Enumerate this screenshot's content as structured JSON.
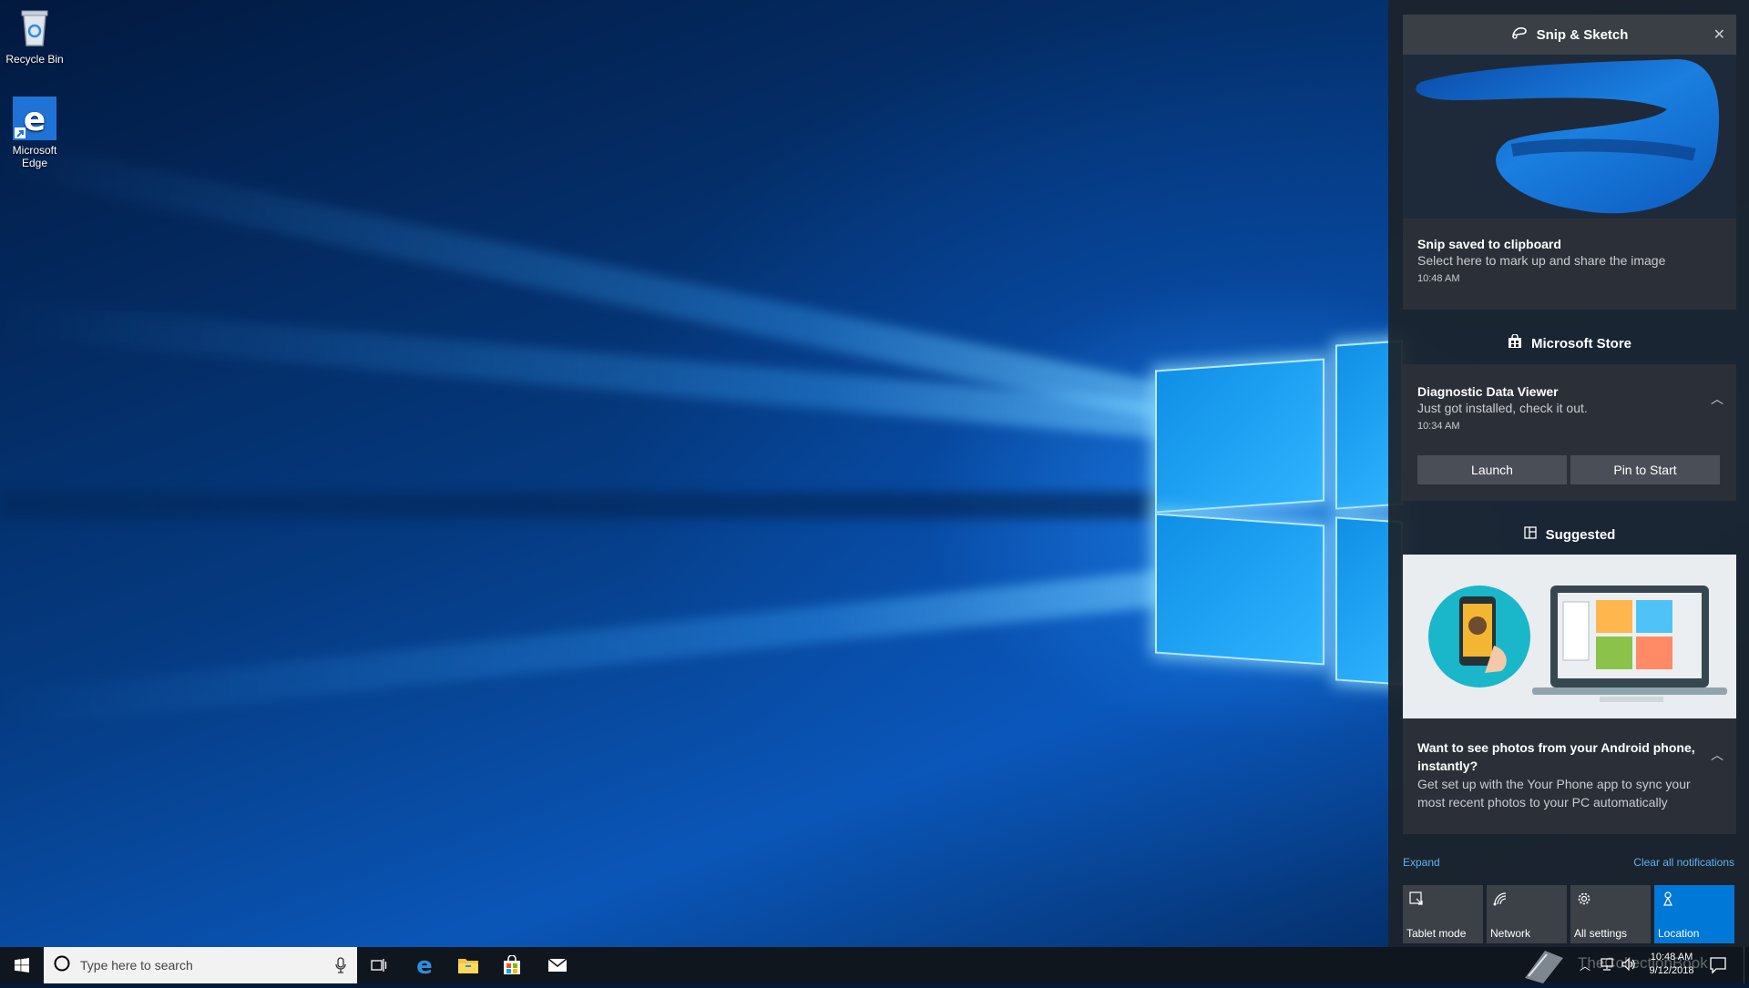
{
  "desktop": {
    "icons": [
      {
        "label": "Recycle Bin",
        "icon": "recycle-bin-icon"
      },
      {
        "label": "Microsoft Edge",
        "icon": "edge-icon"
      }
    ]
  },
  "action_center": {
    "snip": {
      "app_name": "Snip & Sketch",
      "title": "Snip saved to clipboard",
      "body": "Select here to mark up and share the image",
      "time": "10:48 AM"
    },
    "store": {
      "app_name": "Microsoft Store",
      "title": "Diagnostic Data Viewer",
      "body": "Just got installed, check it out.",
      "time": "10:34 AM",
      "buttons": [
        "Launch",
        "Pin to Start"
      ]
    },
    "suggested": {
      "app_name": "Suggested",
      "title": "Want to see photos from your Android phone, instantly?",
      "body": "Get set up with the Your Phone app to sync your most recent photos to your PC automatically"
    },
    "expand_label": "Expand",
    "clear_label": "Clear all notifications",
    "quick_actions": [
      {
        "label": "Tablet mode",
        "icon": "tablet-mode-icon",
        "active": false
      },
      {
        "label": "Network",
        "icon": "network-icon",
        "active": false
      },
      {
        "label": "All settings",
        "icon": "settings-icon",
        "active": false
      },
      {
        "label": "Location",
        "icon": "location-icon",
        "active": true
      }
    ]
  },
  "taskbar": {
    "search_placeholder": "Type here to search",
    "watermark": "TheCollectionBook",
    "clock_time": "10:48 AM",
    "clock_date": "9/12/2018"
  },
  "colors": {
    "accent": "#0078d7",
    "action_center_bg": "#1c222a",
    "link": "#5fb2f2"
  }
}
